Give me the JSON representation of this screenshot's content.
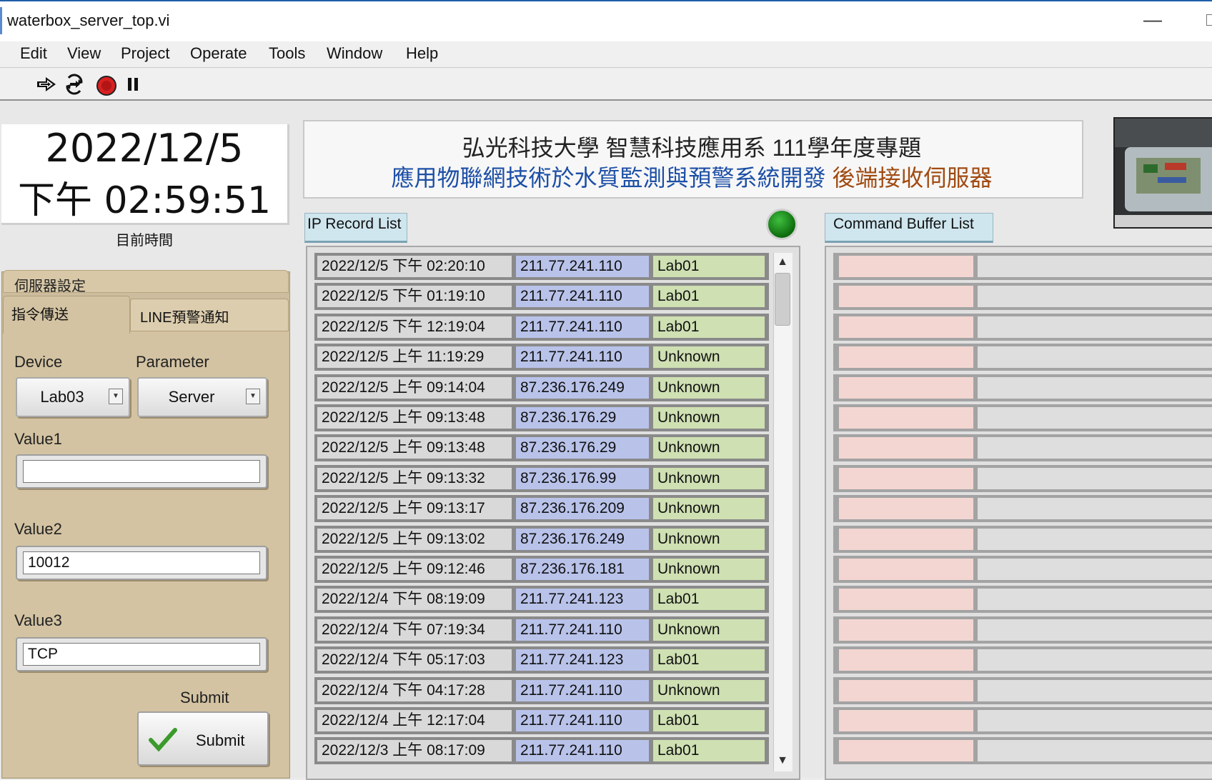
{
  "window": {
    "title": "waterbox_server_top.vi",
    "minimize_glyph": "—"
  },
  "menu": [
    "Edit",
    "View",
    "Project",
    "Operate",
    "Tools",
    "Window",
    "Help"
  ],
  "toolbar": {
    "icons": [
      "run-arrow-icon",
      "run-continuously-icon",
      "abort-stop-icon",
      "pause-icon"
    ]
  },
  "clock": {
    "date": "2022/12/5",
    "time": "下午 02:59:51",
    "label": "目前時間"
  },
  "banner": {
    "line1": "弘光科技大學 智慧科技應用系 111學年度專題",
    "line2_blue": "應用物聯網技術於水質監測與預警系統開發",
    "line2_brown": "後端接收伺服器"
  },
  "tabs": {
    "top_label": "伺服器設定",
    "active_label": "指令傳送",
    "inactive_label": "LINE預警通知"
  },
  "form": {
    "device_label": "Device",
    "device_value": "Lab03",
    "parameter_label": "Parameter",
    "parameter_value": "Server",
    "value1_label": "Value1",
    "value1": "",
    "value2_label": "Value2",
    "value2": "10012",
    "value3_label": "Value3",
    "value3": "TCP",
    "submit_caption": "Submit",
    "submit_button": "Submit"
  },
  "ip_record": {
    "label": "IP Record List",
    "rows": [
      {
        "time": "2022/12/5 下午 02:20:10",
        "ip": "211.77.241.110",
        "name": "Lab01"
      },
      {
        "time": "2022/12/5 下午 01:19:10",
        "ip": "211.77.241.110",
        "name": "Lab01"
      },
      {
        "time": "2022/12/5 下午 12:19:04",
        "ip": "211.77.241.110",
        "name": "Lab01"
      },
      {
        "time": "2022/12/5 上午 11:19:29",
        "ip": "211.77.241.110",
        "name": "Unknown"
      },
      {
        "time": "2022/12/5 上午 09:14:04",
        "ip": "87.236.176.249",
        "name": "Unknown"
      },
      {
        "time": "2022/12/5 上午 09:13:48",
        "ip": "87.236.176.29",
        "name": "Unknown"
      },
      {
        "time": "2022/12/5 上午 09:13:48",
        "ip": "87.236.176.29",
        "name": "Unknown"
      },
      {
        "time": "2022/12/5 上午 09:13:32",
        "ip": "87.236.176.99",
        "name": "Unknown"
      },
      {
        "time": "2022/12/5 上午 09:13:17",
        "ip": "87.236.176.209",
        "name": "Unknown"
      },
      {
        "time": "2022/12/5 上午 09:13:02",
        "ip": "87.236.176.249",
        "name": "Unknown"
      },
      {
        "time": "2022/12/5 上午 09:12:46",
        "ip": "87.236.176.181",
        "name": "Unknown"
      },
      {
        "time": "2022/12/4 下午 08:19:09",
        "ip": "211.77.241.123",
        "name": "Lab01"
      },
      {
        "time": "2022/12/4 下午 07:19:34",
        "ip": "211.77.241.110",
        "name": "Unknown"
      },
      {
        "time": "2022/12/4 下午 05:17:03",
        "ip": "211.77.241.123",
        "name": "Lab01"
      },
      {
        "time": "2022/12/4 下午 04:17:28",
        "ip": "211.77.241.110",
        "name": "Unknown"
      },
      {
        "time": "2022/12/4 上午 12:17:04",
        "ip": "211.77.241.110",
        "name": "Lab01"
      },
      {
        "time": "2022/12/3 上午 08:17:09",
        "ip": "211.77.241.110",
        "name": "Lab01"
      }
    ]
  },
  "command_buffer": {
    "label": "Command Buffer List",
    "row_count": 17
  },
  "colors": {
    "led_on": "#1f9a1f",
    "tab_bg": "#d3c3a2",
    "banner_blue": "#1d4fa6",
    "banner_brown": "#a04b12"
  }
}
